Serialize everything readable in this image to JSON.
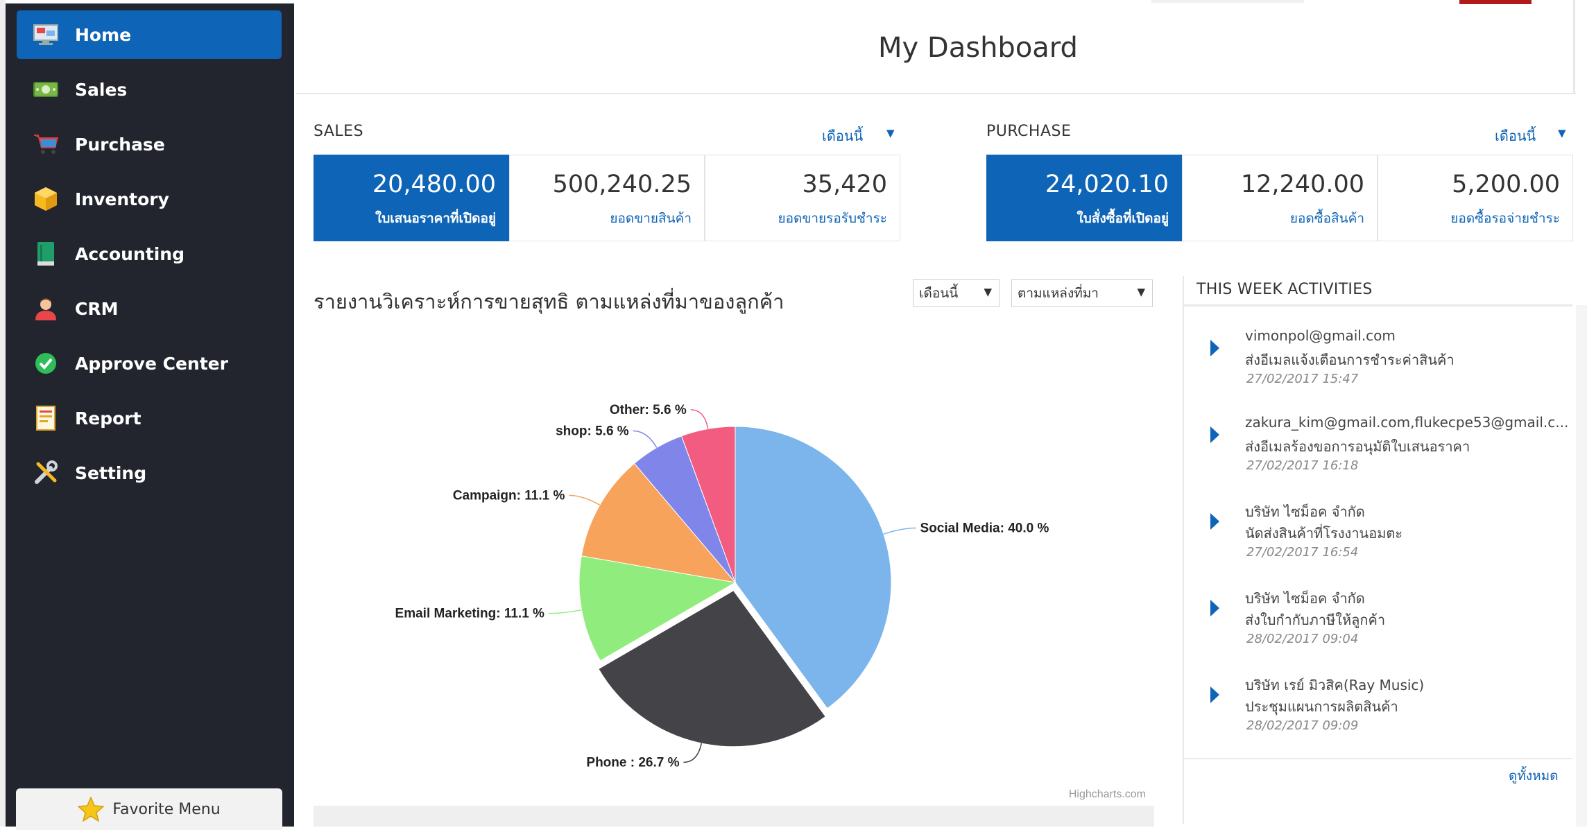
{
  "sidebar": {
    "items": [
      {
        "label": "Home",
        "icon": "monitor-icon",
        "active": true
      },
      {
        "label": "Sales",
        "icon": "money-icon",
        "active": false
      },
      {
        "label": "Purchase",
        "icon": "cart-icon",
        "active": false
      },
      {
        "label": "Inventory",
        "icon": "box-icon",
        "active": false
      },
      {
        "label": "Accounting",
        "icon": "book-icon",
        "active": false
      },
      {
        "label": "CRM",
        "icon": "user-icon",
        "active": false
      },
      {
        "label": "Approve Center",
        "icon": "check-circle-icon",
        "active": false
      },
      {
        "label": "Report",
        "icon": "report-icon",
        "active": false
      },
      {
        "label": "Setting",
        "icon": "tools-icon",
        "active": false
      }
    ],
    "favorite_label": "Favorite Menu"
  },
  "page_title": "My Dashboard",
  "sales": {
    "label": "SALES",
    "period": "เดือนนี้",
    "kpis": [
      {
        "value": "20,480.00",
        "label": "ใบเสนอราคาที่เปิดอยู่"
      },
      {
        "value": "500,240.25",
        "label": "ยอดขายสินค้า"
      },
      {
        "value": "35,420",
        "label": "ยอดขายรอรับชำระ"
      }
    ]
  },
  "purchase": {
    "label": "PURCHASE",
    "period": "เดือนนี้",
    "kpis": [
      {
        "value": "24,020.10",
        "label": "ใบสั่งซื้อที่เปิดอยู่"
      },
      {
        "value": "12,240.00",
        "label": "ยอดซื้อสินค้า"
      },
      {
        "value": "5,200.00",
        "label": "ยอดซื้อรอจ่ายชำระ"
      }
    ]
  },
  "report": {
    "title": "รายงานวิเคราะห์การขายสุทธิ ตามแหล่งที่มาของลูกค้า",
    "period_select": "เดือนนี้",
    "group_select": "ตามแหล่งที่มา",
    "credit": "Highcharts.com"
  },
  "chart_data": {
    "type": "pie",
    "title": "",
    "unit": "%",
    "slices": [
      {
        "name": "Social Media",
        "value": 40.0,
        "color": "#7cb5ec"
      },
      {
        "name": "Phone ",
        "value": 26.7,
        "color": "#434348"
      },
      {
        "name": "Email Marketing",
        "value": 11.1,
        "color": "#90ed7d"
      },
      {
        "name": "Campaign",
        "value": 11.1,
        "color": "#f7a35c"
      },
      {
        "name": "shop",
        "value": 5.6,
        "color": "#8085e9"
      },
      {
        "name": "Other",
        "value": 5.6,
        "color": "#f15c80"
      }
    ],
    "sliced": "Phone "
  },
  "activities": {
    "heading": "THIS WEEK ACTIVITIES",
    "items": [
      {
        "who": "vimonpol@gmail.com",
        "what": "ส่งอีเมลแจ้งเตือนการชำระค่าสินค้า",
        "time": "27/02/2017 15:47"
      },
      {
        "who": "zakura_kim@gmail.com,flukecpe53@gmail.c...",
        "what": "ส่งอีเมลร้องขอการอนุมัติใบเสนอราคา",
        "time": "27/02/2017 16:18"
      },
      {
        "who": "บริษัท ไซม็อค จำกัด",
        "what": "นัดส่งสินค้าที่โรงงานอมตะ",
        "time": "27/02/2017 16:54"
      },
      {
        "who": "บริษัท ไซม็อค จำกัด",
        "what": "ส่งใบกำกับภาษีให้ลูกค้า",
        "time": "28/02/2017 09:04"
      },
      {
        "who": "บริษัท เรย์ มิวสิค(Ray Music)",
        "what": "ประชุมแผนการผลิตสินค้า",
        "time": "28/02/2017 09:09"
      }
    ],
    "view_all": "ดูทั้งหมด"
  },
  "colors": {
    "primary": "#0e64b6",
    "sidebar": "#22252e",
    "accent_red": "#b31b1b"
  }
}
